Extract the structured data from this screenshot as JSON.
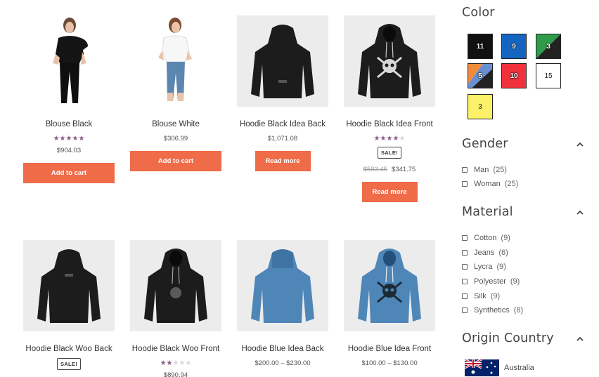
{
  "products": [
    {
      "name": "Blouse Black",
      "price": "$904.03",
      "rating": 5,
      "button": "Add to cart",
      "image": "woman-black-blouse"
    },
    {
      "name": "Blouse White",
      "price": "$306.99",
      "button": "Add to cart",
      "image": "woman-white-blouse"
    },
    {
      "name": "Hoodie Black Idea Back",
      "price": "$1,071.08",
      "button": "Read more",
      "image": "hoodie-black-back"
    },
    {
      "name": "Hoodie Black Idea Front",
      "rating": 4,
      "sale_badge": "SALE!",
      "old_price": "$503.45",
      "price": "$341.75",
      "button": "Read more",
      "image": "hoodie-black-front-skull"
    },
    {
      "name": "Hoodie Black Woo Back",
      "sale_badge": "SALE!",
      "image": "hoodie-black-back"
    },
    {
      "name": "Hoodie Black Woo Front",
      "rating": 2,
      "price": "$890.94",
      "image": "hoodie-black-front-skull"
    },
    {
      "name": "Hoodie Blue Idea Back",
      "price": "$200.00 – $230.00",
      "image": "hoodie-blue-back"
    },
    {
      "name": "Hoodie Blue Idea Front",
      "price": "$100.00 – $130.00",
      "image": "hoodie-blue-front-skull"
    }
  ],
  "filters": {
    "color": {
      "title": "Color",
      "swatches": [
        {
          "count": "11",
          "colors": [
            "#111111"
          ]
        },
        {
          "count": "9",
          "colors": [
            "#1565c0"
          ]
        },
        {
          "count": "3",
          "colors": [
            "#2e9c4a",
            "#222222"
          ]
        },
        {
          "count": "5",
          "colors": [
            "#f08a3c",
            "#6a8fd0",
            "#222222"
          ]
        },
        {
          "count": "10",
          "colors": [
            "#f0323c"
          ]
        },
        {
          "count": "15",
          "colors": [
            "#ffffff"
          ]
        },
        {
          "count": "3",
          "colors": [
            "#fbf26a"
          ]
        }
      ]
    },
    "gender": {
      "title": "Gender",
      "options": [
        {
          "label": "Man",
          "count": "(25)"
        },
        {
          "label": "Woman",
          "count": "(25)"
        }
      ]
    },
    "material": {
      "title": "Material",
      "options": [
        {
          "label": "Cotton",
          "count": "(9)"
        },
        {
          "label": "Jeans",
          "count": "(6)"
        },
        {
          "label": "Lycra",
          "count": "(9)"
        },
        {
          "label": "Polyester",
          "count": "(9)"
        },
        {
          "label": "Silk",
          "count": "(9)"
        },
        {
          "label": "Synthetics",
          "count": "(8)"
        }
      ]
    },
    "origin": {
      "title": "Origin Country",
      "countries": [
        {
          "label": "Australia",
          "flag": "australia-flag"
        }
      ]
    }
  },
  "colors": {
    "button": "#f06b48",
    "star": "#8a5b88",
    "star_off": "#d8d8d8"
  }
}
